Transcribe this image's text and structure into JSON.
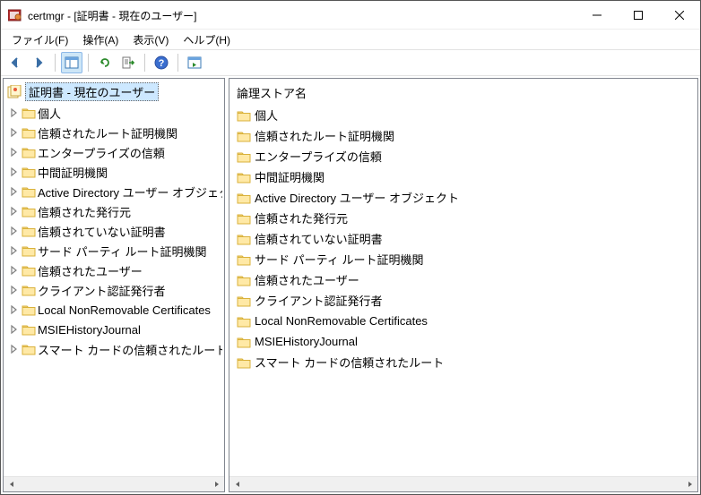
{
  "window": {
    "title": "certmgr - [証明書 - 現在のユーザー]"
  },
  "menu": {
    "file": "ファイル(F)",
    "action": "操作(A)",
    "view": "表示(V)",
    "help": "ヘルプ(H)"
  },
  "tree": {
    "root": "証明書 - 現在のユーザー",
    "items": [
      {
        "label": "個人"
      },
      {
        "label": "信頼されたルート証明機関"
      },
      {
        "label": "エンタープライズの信頼"
      },
      {
        "label": "中間証明機関"
      },
      {
        "label": "Active Directory ユーザー オブジェクト"
      },
      {
        "label": "信頼された発行元"
      },
      {
        "label": "信頼されていない証明書"
      },
      {
        "label": "サード パーティ ルート証明機関"
      },
      {
        "label": "信頼されたユーザー"
      },
      {
        "label": "クライアント認証発行者"
      },
      {
        "label": "Local NonRemovable Certificates"
      },
      {
        "label": "MSIEHistoryJournal"
      },
      {
        "label": "スマート カードの信頼されたルート"
      }
    ]
  },
  "list": {
    "header": "論理ストア名",
    "items": [
      {
        "label": "個人"
      },
      {
        "label": "信頼されたルート証明機関"
      },
      {
        "label": "エンタープライズの信頼"
      },
      {
        "label": "中間証明機関"
      },
      {
        "label": "Active Directory ユーザー オブジェクト"
      },
      {
        "label": "信頼された発行元"
      },
      {
        "label": "信頼されていない証明書"
      },
      {
        "label": "サード パーティ ルート証明機関"
      },
      {
        "label": "信頼されたユーザー"
      },
      {
        "label": "クライアント認証発行者"
      },
      {
        "label": "Local NonRemovable Certificates"
      },
      {
        "label": "MSIEHistoryJournal"
      },
      {
        "label": "スマート カードの信頼されたルート"
      }
    ]
  }
}
